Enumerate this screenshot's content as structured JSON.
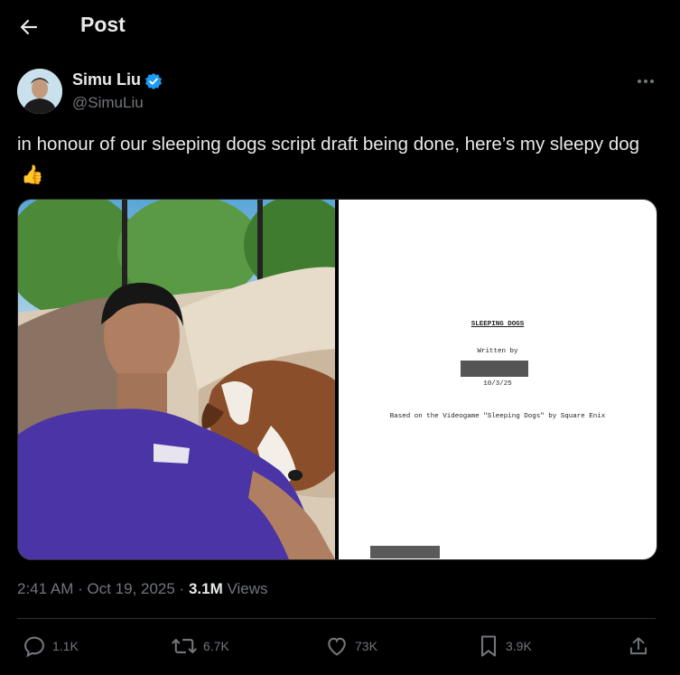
{
  "header": {
    "title": "Post",
    "back_icon": "arrow-left-icon"
  },
  "author": {
    "name": "Simu Liu",
    "handle": "@SimuLiu",
    "verified": true,
    "verified_color": "#1d9bf0"
  },
  "more_icon": "more-horizontal-icon",
  "post": {
    "text": "in honour of our sleeping dogs script draft being done, here’s my sleepy dog",
    "emoji": "👍"
  },
  "media": {
    "document": {
      "title": "SLEEPING DOGS",
      "written_by": "Written by",
      "date": "10/3/25",
      "based_on": "Based on the Videogame \"Sleeping Dogs\" by Square Enix"
    }
  },
  "meta": {
    "time": "2:41 AM",
    "date": "Oct 19, 2025",
    "views_count": "3.1M",
    "views_label": "Views"
  },
  "actions": {
    "replies": "1.1K",
    "reposts": "6.7K",
    "likes": "73K",
    "bookmarks": "3.9K"
  },
  "colors": {
    "background": "#000000",
    "text": "#e7e9ea",
    "muted": "#71767b",
    "border": "#2f3336"
  }
}
